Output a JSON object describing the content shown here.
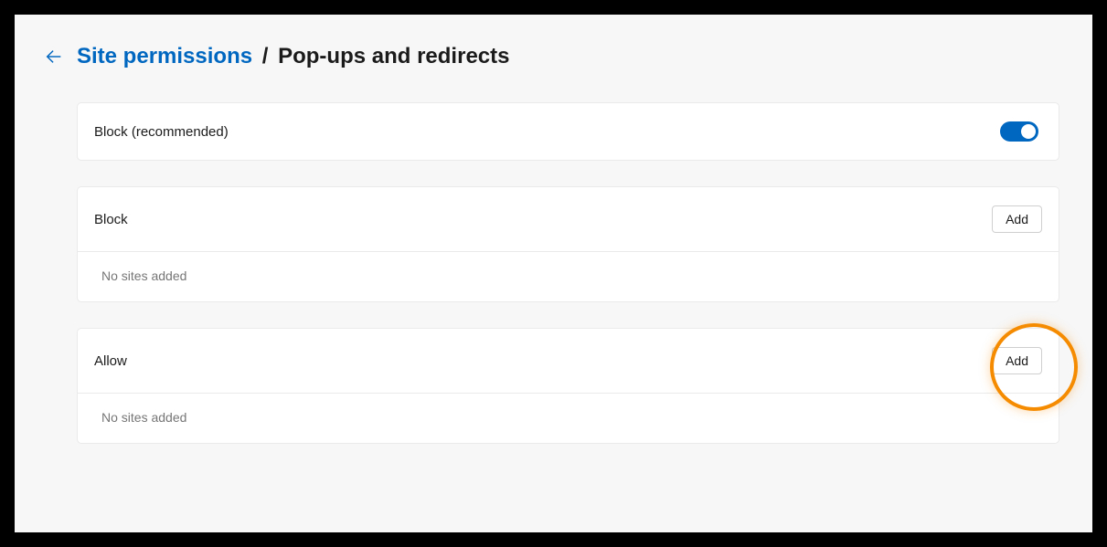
{
  "breadcrumb": {
    "parent": "Site permissions",
    "separator": "/",
    "current": "Pop-ups and redirects"
  },
  "blockRecommended": {
    "label": "Block (recommended)",
    "toggleOn": true
  },
  "blockSection": {
    "title": "Block",
    "addLabel": "Add",
    "emptyText": "No sites added"
  },
  "allowSection": {
    "title": "Allow",
    "addLabel": "Add",
    "emptyText": "No sites added"
  }
}
